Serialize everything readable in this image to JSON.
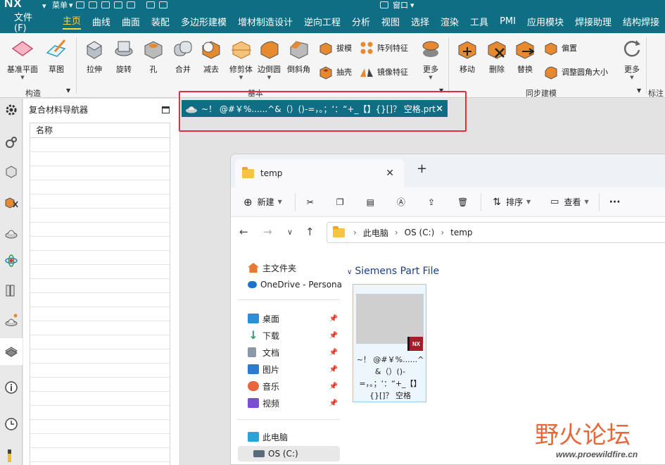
{
  "app": {
    "logo": "NX",
    "menu_label": "菜单",
    "window_label": "窗口"
  },
  "menubar": {
    "file": "文件(F)",
    "items": [
      "主页",
      "曲线",
      "曲面",
      "装配",
      "多边形建模",
      "增材制造设计",
      "逆向工程",
      "分析",
      "视图",
      "选择",
      "渲染",
      "工具",
      "PMI",
      "应用模块",
      "焊接助理",
      "结构焊接"
    ],
    "active_index": 0
  },
  "ribbon": {
    "construct": {
      "datum": "基准平面",
      "sketch": "草图",
      "group": "构造"
    },
    "basic": {
      "extrude": "拉伸",
      "revolve": "旋转",
      "hole": "孔",
      "unite": "合并",
      "subtract": "减去",
      "trim_body": "修剪体",
      "edge_blend": "边倒圆",
      "chamfer": "倒斜角",
      "draft": "拔模",
      "shell": "抽壳",
      "pattern": "阵列特征",
      "mirror": "镜像特征",
      "more": "更多",
      "group": "基本"
    },
    "sync": {
      "move": "移动",
      "delete": "删除",
      "replace": "替换",
      "offset": "偏置",
      "resize_blend": "调整圆角大小",
      "more": "更多",
      "group": "同步建模"
    },
    "extra_group": "标注"
  },
  "navigator": {
    "title": "复合材料导航器",
    "column": "名称"
  },
  "doc_tab": {
    "title": "~！ @#￥%......^&（）()-=，。；‘：“+_【】{}[]？ 空格.prt",
    "close": "×"
  },
  "explorer": {
    "tab_title": "temp",
    "toolbar": {
      "new": "新建",
      "sort": "排序",
      "view": "查看",
      "more": "···"
    },
    "breadcrumb": [
      "此电脑",
      "OS (C:)",
      "temp"
    ],
    "sidebar": {
      "home": "主文件夹",
      "onedrive": "OneDrive - Persona",
      "pinned": [
        "桌面",
        "下载",
        "文档",
        "图片",
        "音乐",
        "视频"
      ],
      "this_pc": "此电脑",
      "drive": "OS (C:)"
    },
    "group_header": "Siemens Part File",
    "file": {
      "name": "~！ @#￥%......^&（）()-=，。；‘：“+_【】{}[]？ 空格",
      "badge": "NX"
    }
  },
  "watermark": {
    "text": "野火论坛",
    "url": "www.proewildfire.cn"
  },
  "colors": {
    "title_bar": "#0f6e84",
    "active_menu": "#ffd44a",
    "highlight_box": "#e0303a",
    "folder": "#f6c343"
  }
}
